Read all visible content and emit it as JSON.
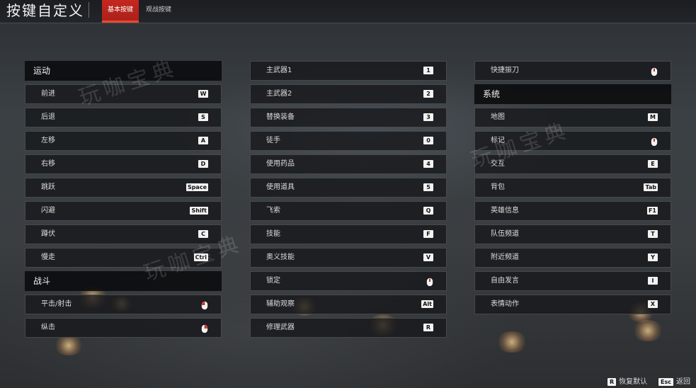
{
  "header": {
    "title": "按键自定义",
    "tabs": [
      {
        "label": "基本按键",
        "active": true
      },
      {
        "label": "观战按键",
        "active": false
      }
    ]
  },
  "watermark": "玩咖宝典",
  "columns": [
    {
      "rows": [
        {
          "type": "section",
          "label": "运动"
        },
        {
          "type": "bind",
          "label": "前进",
          "key": "W"
        },
        {
          "type": "bind",
          "label": "后退",
          "key": "S"
        },
        {
          "type": "bind",
          "label": "左移",
          "key": "A"
        },
        {
          "type": "bind",
          "label": "右移",
          "key": "D"
        },
        {
          "type": "bind",
          "label": "跳跃",
          "key": "Space"
        },
        {
          "type": "bind",
          "label": "闪避",
          "key": "Shift"
        },
        {
          "type": "bind",
          "label": "蹲伏",
          "key": "C"
        },
        {
          "type": "bind",
          "label": "慢走",
          "key": "Ctrl"
        },
        {
          "type": "section",
          "label": "战斗"
        },
        {
          "type": "bind",
          "label": "平击/射击",
          "key": "",
          "icon": "mouse-left-icon"
        },
        {
          "type": "bind",
          "label": "纵击",
          "key": "",
          "icon": "mouse-right-icon"
        }
      ]
    },
    {
      "rows": [
        {
          "type": "bind",
          "label": "主武器1",
          "key": "1"
        },
        {
          "type": "bind",
          "label": "主武器2",
          "key": "2"
        },
        {
          "type": "bind",
          "label": "替换装备",
          "key": "3"
        },
        {
          "type": "bind",
          "label": "徒手",
          "key": "0"
        },
        {
          "type": "bind",
          "label": "使用药品",
          "key": "4"
        },
        {
          "type": "bind",
          "label": "使用道具",
          "key": "5"
        },
        {
          "type": "bind",
          "label": "飞索",
          "key": "Q"
        },
        {
          "type": "bind",
          "label": "技能",
          "key": "F"
        },
        {
          "type": "bind",
          "label": "奥义技能",
          "key": "V"
        },
        {
          "type": "bind",
          "label": "锁定",
          "key": "",
          "icon": "mouse-middle-icon"
        },
        {
          "type": "bind",
          "label": "辅助观察",
          "key": "Alt"
        },
        {
          "type": "bind",
          "label": "修理武器",
          "key": "R"
        }
      ]
    },
    {
      "rows": [
        {
          "type": "bind",
          "label": "快捷振刀",
          "key": "",
          "icon": "mouse-middle-icon"
        },
        {
          "type": "section",
          "label": "系统"
        },
        {
          "type": "bind",
          "label": "地图",
          "key": "M"
        },
        {
          "type": "bind",
          "label": "标记",
          "key": "",
          "icon": "mouse-middle-icon"
        },
        {
          "type": "bind",
          "label": "交互",
          "key": "E"
        },
        {
          "type": "bind",
          "label": "背包",
          "key": "Tab"
        },
        {
          "type": "bind",
          "label": "英雄信息",
          "key": "F1"
        },
        {
          "type": "bind",
          "label": "队伍频道",
          "key": "T"
        },
        {
          "type": "bind",
          "label": "附近频道",
          "key": "Y"
        },
        {
          "type": "bind",
          "label": "自由发言",
          "key": "I"
        },
        {
          "type": "bind",
          "label": "表情动作",
          "key": "X"
        }
      ]
    }
  ],
  "footer": {
    "restore": {
      "key": "R",
      "label": "恢复默认"
    },
    "back": {
      "key": "Esc",
      "label": "返回"
    }
  },
  "colors": {
    "accent": "#c5271f",
    "mouse_highlight": "#e03a2a"
  }
}
